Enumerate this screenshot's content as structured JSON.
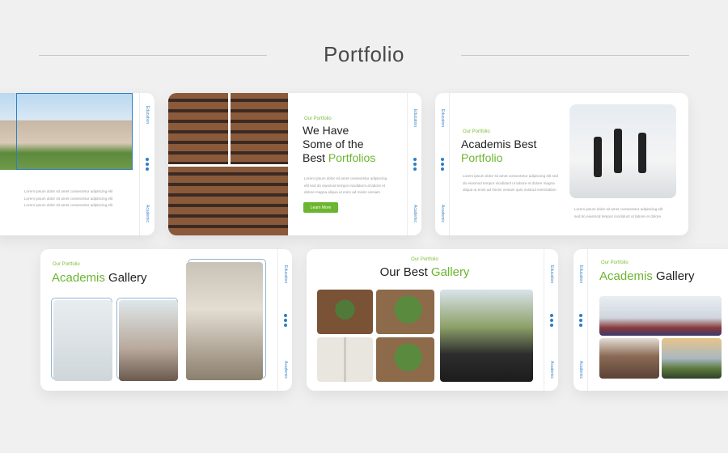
{
  "page": {
    "title": "Portfolio"
  },
  "side": {
    "left": "Education",
    "right": "Academic"
  },
  "slides": {
    "s1": {
      "para": [
        "Lorem ipsum dolor sit amet consectetur adipiscing elit",
        "Lorem ipsum dolor sit amet consectetur adipiscing elit",
        "Lorem ipsum dolor sit amet consectetur adipiscing elit"
      ]
    },
    "s2": {
      "eyebrow": "Our Portfolio",
      "line1": "We Have",
      "line2": "Some of the",
      "line3_pre": "Best ",
      "line3_accent": "Portfolios",
      "para": [
        "Lorem ipsum dolor sit amet consectetur adipiscing",
        "elit sed do eiusmod tempor incididunt ut labore et",
        "dolore magna aliqua ut enim ad minim veniam"
      ],
      "button": "Learn More"
    },
    "s3": {
      "eyebrow": "Our Portfolio",
      "line1": "Academis Best",
      "line2_accent": "Portfolio",
      "para": [
        "Lorem ipsum dolor sit amet consectetur adipiscing elit sed",
        "do eiusmod tempor incididunt ut labore et dolore magna",
        "aliqua ut enim ad minim veniam quis nostrud exercitation"
      ],
      "para2": [
        "Lorem ipsum dolor sit amet consectetur adipiscing elit",
        "sed do eiusmod tempor incididunt ut labore et dolore"
      ]
    },
    "s4": {
      "eyebrow": "Our Portfolio",
      "title_accent": "Academis",
      "title_rest": " Gallery"
    },
    "s5": {
      "eyebrow": "Our Portfolio",
      "title_pre": "Our Best ",
      "title_accent": "Gallery"
    },
    "s6": {
      "eyebrow": "Our Portfolio",
      "title_accent": "Academis",
      "title_rest": " Gallery"
    }
  },
  "colors": {
    "accent_green": "#6cb52f",
    "accent_blue": "#2f7fc4"
  }
}
